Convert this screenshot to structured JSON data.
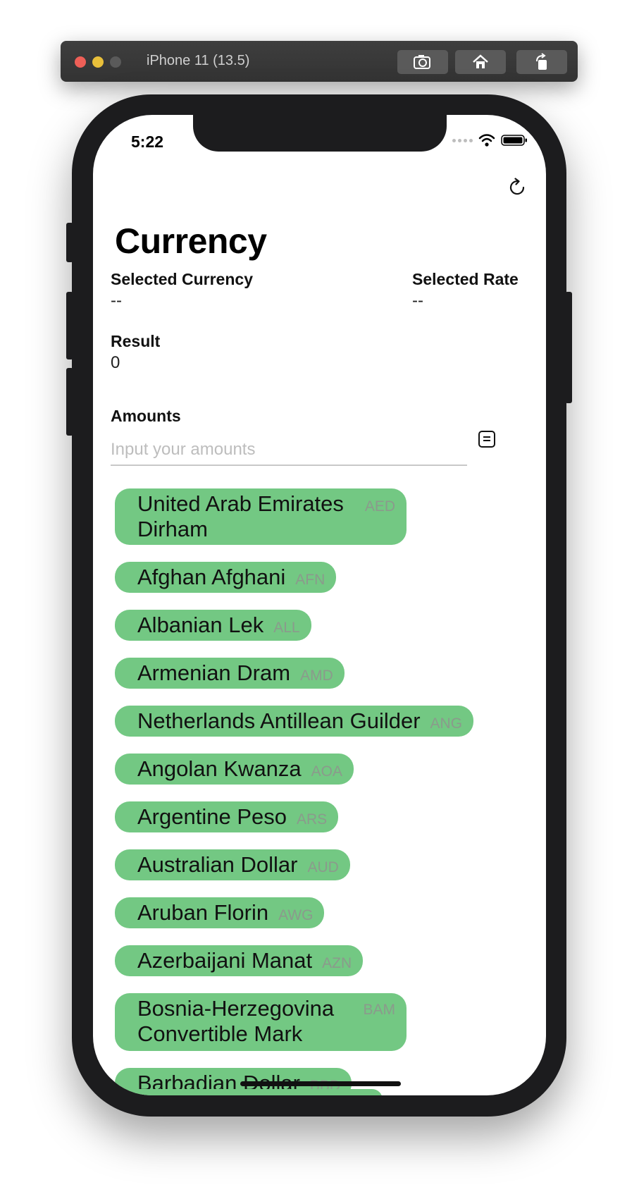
{
  "simulator": {
    "title": "iPhone 11 (13.5)",
    "buttons": [
      "screenshot-icon",
      "home-icon",
      "rotate-icon"
    ]
  },
  "status_bar": {
    "time": "5:22"
  },
  "header": {
    "title": "Currency",
    "refresh_icon": "refresh-icon"
  },
  "selected_currency": {
    "label": "Selected Currency",
    "value": "--"
  },
  "selected_rate": {
    "label": "Selected Rate",
    "value": "--"
  },
  "result": {
    "label": "Result",
    "value": "0"
  },
  "amounts": {
    "label": "Amounts",
    "placeholder": "Input your amounts",
    "icon": "memo-icon"
  },
  "currencies": [
    {
      "name": "United Arab Emirates Dirham",
      "code": "AED"
    },
    {
      "name": "Afghan Afghani",
      "code": "AFN"
    },
    {
      "name": "Albanian Lek",
      "code": "ALL"
    },
    {
      "name": "Armenian Dram",
      "code": "AMD"
    },
    {
      "name": "Netherlands Antillean Guilder",
      "code": "ANG"
    },
    {
      "name": "Angolan Kwanza",
      "code": "AOA"
    },
    {
      "name": "Argentine Peso",
      "code": "ARS"
    },
    {
      "name": "Australian Dollar",
      "code": "AUD"
    },
    {
      "name": "Aruban Florin",
      "code": "AWG"
    },
    {
      "name": "Azerbaijani Manat",
      "code": "AZN"
    },
    {
      "name": "Bosnia-Herzegovina Convertible Mark",
      "code": "BAM"
    },
    {
      "name": "Barbadian Dollar",
      "code": "BBD"
    }
  ],
  "colors": {
    "chip": "#73c883",
    "chip_code": "#8b9a8c"
  }
}
